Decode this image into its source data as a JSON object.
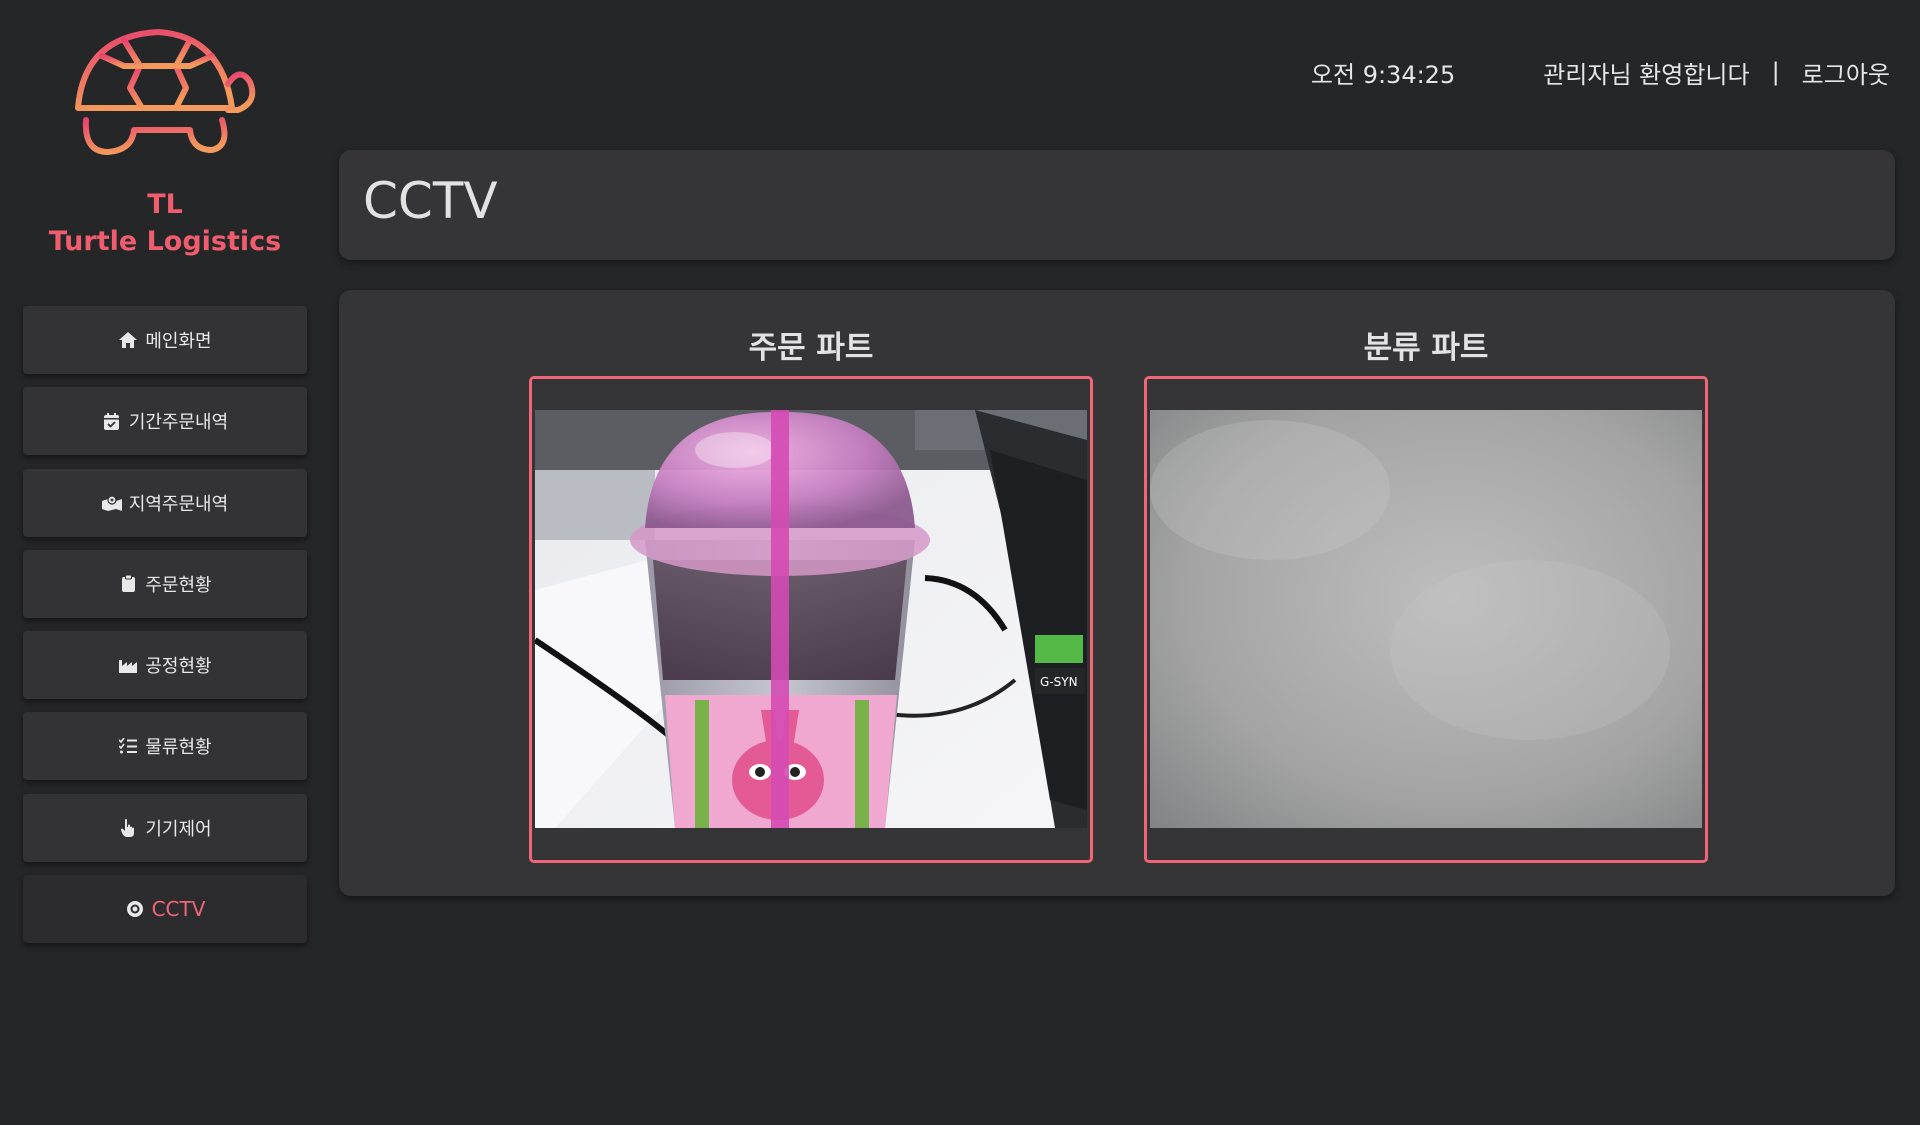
{
  "brand": {
    "abbr": "TL",
    "name": "Turtle Logistics",
    "color": "#ef5d6f"
  },
  "nav": [
    {
      "label": "메인화면",
      "icon": "home-icon",
      "active": false
    },
    {
      "label": "기간주문내역",
      "icon": "calendar-check-icon",
      "active": false
    },
    {
      "label": "지역주문내역",
      "icon": "map-marked-icon",
      "active": false
    },
    {
      "label": "주문현황",
      "icon": "clipboard-icon",
      "active": false
    },
    {
      "label": "공정현황",
      "icon": "industry-icon",
      "active": false
    },
    {
      "label": "물류현황",
      "icon": "list-check-icon",
      "active": false
    },
    {
      "label": "기기제어",
      "icon": "hand-pointer-icon",
      "active": false
    },
    {
      "label": "CCTV",
      "icon": "camera-lens-icon",
      "active": true
    }
  ],
  "header": {
    "clock": "오전 9:34:25",
    "welcome": "관리자님 환영합니다",
    "separator": "|",
    "logout": "로그아웃"
  },
  "page": {
    "title": "CCTV"
  },
  "cameras": [
    {
      "label": "주문 파트",
      "feed": "drink-cup-on-desk"
    },
    {
      "label": "분류 파트",
      "feed": "blurred-gray-surface"
    }
  ],
  "colors": {
    "accent": "#f06676",
    "background": "#252628",
    "card": "#353537"
  }
}
